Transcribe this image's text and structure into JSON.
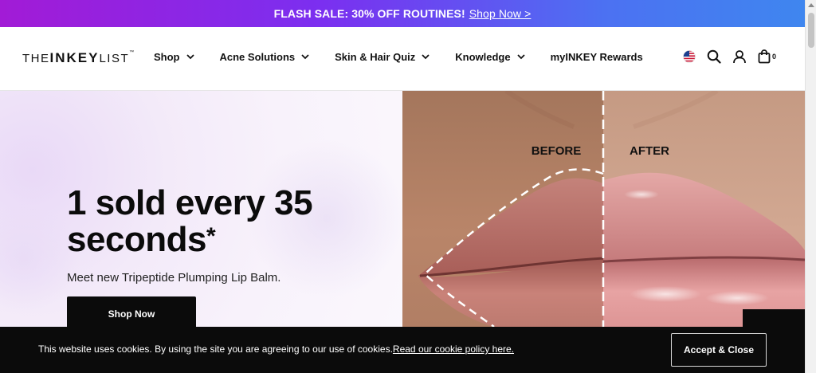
{
  "promo": {
    "text": "FLASH SALE: 30% OFF ROUTINES!",
    "link": "Shop Now >"
  },
  "brand": {
    "logo_left": "THE",
    "logo_mid": "INKEY",
    "logo_right": "LIST",
    "logo_mark": "™"
  },
  "nav": {
    "items": [
      {
        "label": "Shop"
      },
      {
        "label": "Acne Solutions"
      },
      {
        "label": "Skin & Hair Quiz"
      },
      {
        "label": "Knowledge"
      },
      {
        "label": "myINKEY Rewards"
      }
    ]
  },
  "header_icons": {
    "flag": "us-flag-icon",
    "search": "search-icon",
    "account": "user-icon",
    "cart": "shopping-bag-icon",
    "cart_count": "0"
  },
  "hero": {
    "title": "1 sold every 35 seconds",
    "asterisk": "*",
    "subtitle": "Meet new Tripeptide Plumping Lip Balm.",
    "cta": "Shop Now",
    "before_label": "BEFORE",
    "after_label": "AFTER"
  },
  "cookie": {
    "text": "This website uses cookies. By using the site you are agreeing to our use of cookies.",
    "link": "Read our cookie policy here.",
    "accept": "Accept & Close"
  },
  "colors": {
    "promo_start": "#a21bd6",
    "promo_end": "#3f86ef",
    "dark": "#0b0b0b"
  }
}
